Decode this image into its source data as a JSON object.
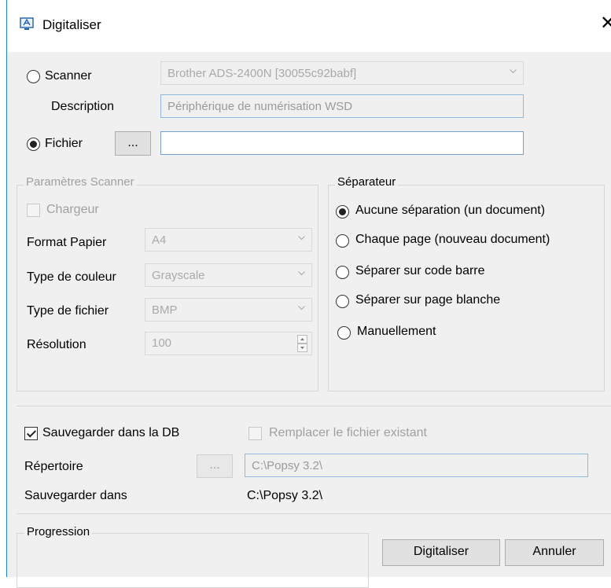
{
  "window": {
    "title": "Digitaliser",
    "close_glyph": "✕"
  },
  "source": {
    "scanner_label": "Scanner",
    "scanner_selected": false,
    "scanner_device": "Brother ADS-2400N [30055c92babf]",
    "description_label": "Description",
    "description_value": "Périphérique de numérisation WSD",
    "fichier_label": "Fichier",
    "fichier_selected": true,
    "browse_label": "...",
    "fichier_value": ""
  },
  "scanner_params": {
    "title": "Paramètres Scanner",
    "chargeur_label": "Chargeur",
    "chargeur_checked": false,
    "format_label": "Format Papier",
    "format_value": "A4",
    "couleur_label": "Type de couleur",
    "couleur_value": "Grayscale",
    "fichier_type_label": "Type de fichier",
    "fichier_type_value": "BMP",
    "resolution_label": "Résolution",
    "resolution_value": "100"
  },
  "separator": {
    "title": "Séparateur",
    "options": [
      {
        "label": "Aucune séparation (un document)",
        "selected": true
      },
      {
        "label": "Chaque page (nouveau document)",
        "selected": false
      },
      {
        "label": "Séparer sur code barre",
        "selected": false
      },
      {
        "label": "Séparer sur page blanche",
        "selected": false
      },
      {
        "label": "Manuellement",
        "selected": false
      }
    ]
  },
  "save": {
    "db_label": "Sauvegarder dans la DB",
    "db_checked": true,
    "replace_label": "Remplacer le fichier existant",
    "replace_checked": false,
    "repertoire_label": "Répertoire",
    "browse_label": "...",
    "repertoire_value": "C:\\Popsy 3.2\\",
    "save_in_label": "Sauvegarder dans",
    "save_in_value": "C:\\Popsy 3.2\\"
  },
  "progress": {
    "title": "Progression"
  },
  "buttons": {
    "digitaliser": "Digitaliser",
    "annuler": "Annuler"
  },
  "colors": {
    "accent_border": "#1883d7",
    "client_bg": "#f0f0f0",
    "disabled_text": "#a0a0a0"
  },
  "icons": {
    "app": "scanner-monitor-icon",
    "combo_arrow": "chevron-down-icon"
  }
}
